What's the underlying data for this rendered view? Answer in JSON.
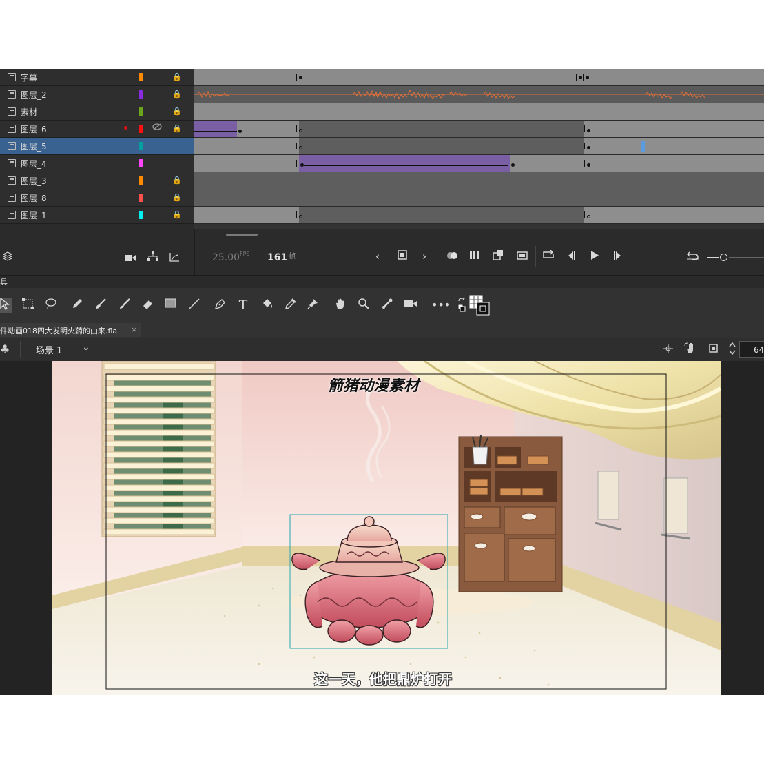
{
  "layers": [
    {
      "name": "字幕",
      "color": "#ff8a00",
      "locked": true
    },
    {
      "name": "图层_2",
      "color": "#8a2be2",
      "locked": true
    },
    {
      "name": "素材",
      "color": "#6aa51b",
      "locked": true
    },
    {
      "name": "图层_6",
      "color": "#ff1010",
      "locked": true,
      "hidden": true,
      "active_dot": true
    },
    {
      "name": "图层_5",
      "color": "#00a0a0",
      "locked": false,
      "selected": true
    },
    {
      "name": "图层_4",
      "color": "#ff44ff",
      "locked": false
    },
    {
      "name": "图层_3",
      "color": "#ff8a00",
      "locked": true
    },
    {
      "name": "图层_8",
      "color": "#ff5050",
      "locked": true
    },
    {
      "name": "图层_1",
      "color": "#00f0f0",
      "locked": true
    }
  ],
  "timeline": {
    "fps_value": "25.00",
    "fps_unit": "FPS",
    "frame_value": "161",
    "frame_unit": "帧"
  },
  "tools_panel_label": "具",
  "document": {
    "tab_title": "件动画018四大发明火药的由来.fla",
    "tab_close": "×",
    "scene_label": "场景 1",
    "zoom_value": "64"
  },
  "stage": {
    "watermark_text": "箭猪动漫素材",
    "subtitle_text": "这一天，他把鼎炉打开"
  },
  "icons": {
    "lock": "lock-icon",
    "eye_hidden": "eye-hidden-icon",
    "layers": "layers-icon",
    "camera": "camera-icon",
    "hierarchy": "hierarchy-icon",
    "graph": "graph-icon"
  }
}
